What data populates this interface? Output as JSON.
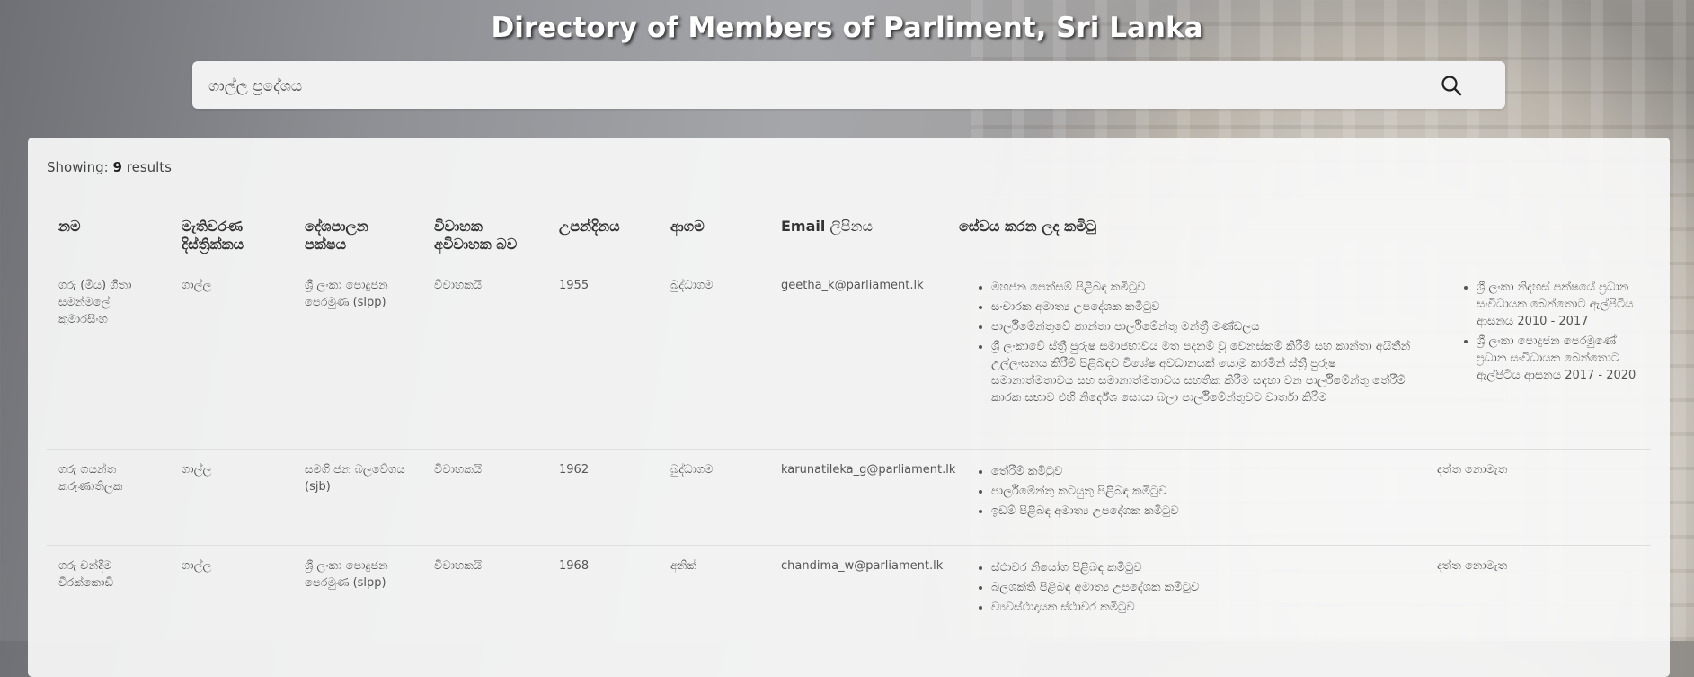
{
  "page": {
    "title": "Directory of Members of Parliment, Sri Lanka"
  },
  "search": {
    "value": "ගාල්ල ප්‍රදේශය",
    "icon": "search-icon"
  },
  "results": {
    "showing_label": "Showing:",
    "count": "9",
    "suffix": "results"
  },
  "table": {
    "headers": {
      "name": "නම",
      "district": "මැතිවරණ දිස්ත්‍රික්කය",
      "party": "දේශපාලන පක්ෂය",
      "marital": "විවාහක අවිවාහක බව",
      "birthday": "උපන්දිනය",
      "religion": "ආගම",
      "email_bold": "Email",
      "email_rest": " ලිපිනය",
      "committees": "සේවය කරන ලද කමිටු"
    },
    "rows": [
      {
        "name": "ගරු (මිය) ගීතා සමන්මලේ කුමාරසිංහ",
        "district": "ගාල්ල",
        "party": "ශ්‍රී ලංකා පොදුජන පෙරමුණ (slpp)",
        "marital": "විවාහකයි",
        "birthday": "1955",
        "religion": "බුද්ධාගම",
        "email": "geetha_k@parliament.lk",
        "committees": [
          "මහජන පෙත්සම් පිළිබඳ කමිටුව",
          "සංචාරක අමාත්‍ය උපදේශක කමිටුව",
          "පාර්ලිමේන්තුවේ කාන්තා පාර්ලිමේන්තු මන්ත්‍රී මණ්ඩලය",
          "ශ්‍රී ලංකාවේ ස්ත්‍රී පුරුෂ සමාජභාවය මත පදනම් වූ වෙනස්කම් කිරීම් සහ කාන්තා අයිතීන් උල්ලංඝනය කිරීම් පිළිබඳව විශේෂ අවධානයක් යොමු කරමින් ස්ත්‍රී පුරුෂ සමානාත්මතාවය සහ සමානාත්මතාවය සහතික කිරීම සඳහා වන පාර්ලිමේන්තු තේරීම් කාරක සභාව එහි නිර්දේශ සොයා බලා පාර්ලිමේන්තුවට වාර්තා කිරීම"
        ],
        "other": [
          "ශ්‍රී ලංකා නිදහස් පක්ෂයේ ප්‍රධාන සංවිධායක බෙන්තොට ඇල්පිටිය ආසනය 2010 - 2017",
          "ශ්‍රී ලංකා පොදුජන පෙරමුණේ ප්‍රධාන සංවිධායක බෙන්තොට ඇල්පිටිය ආසනය 2017 - 2020"
        ]
      },
      {
        "name": "ගරු ගයන්ත කරුණාතිලක",
        "district": "ගාල්ල",
        "party": "සමගි ජන බලවේගය (sjb)",
        "marital": "විවාහකයි",
        "birthday": "1962",
        "religion": "බුද්ධාගම",
        "email": "karunatileka_g@parliament.lk",
        "committees": [
          "තේරීම් කමිටුව",
          "පාර්ලිමේන්තු කටයුතු පිළිබඳ කමිටුව",
          "ඉඩම් පිළිබඳ අමාත්‍ය උපදේශක කමිටුව"
        ],
        "other_text": "දත්ත නොමැත"
      },
      {
        "name": "ගරු චන්දිම වීරක්කොඩි",
        "district": "ගාල්ල",
        "party": "ශ්‍රී ලංකා පොදුජන පෙරමුණ (slpp)",
        "marital": "විවාහකයි",
        "birthday": "1968",
        "religion": "අනික්",
        "email": "chandima_w@parliament.lk",
        "committees": [
          "ස්ථාවර නියෝග පිළිබඳ කමිටුව",
          "බලශක්ති පිළිබඳ අමාත්‍ය උපදේශක කමිටුව",
          "ව්‍යවස්ථාදායක ස්ථාවර කමිටුව"
        ],
        "other_text": "දත්ත නොමැත"
      }
    ]
  }
}
